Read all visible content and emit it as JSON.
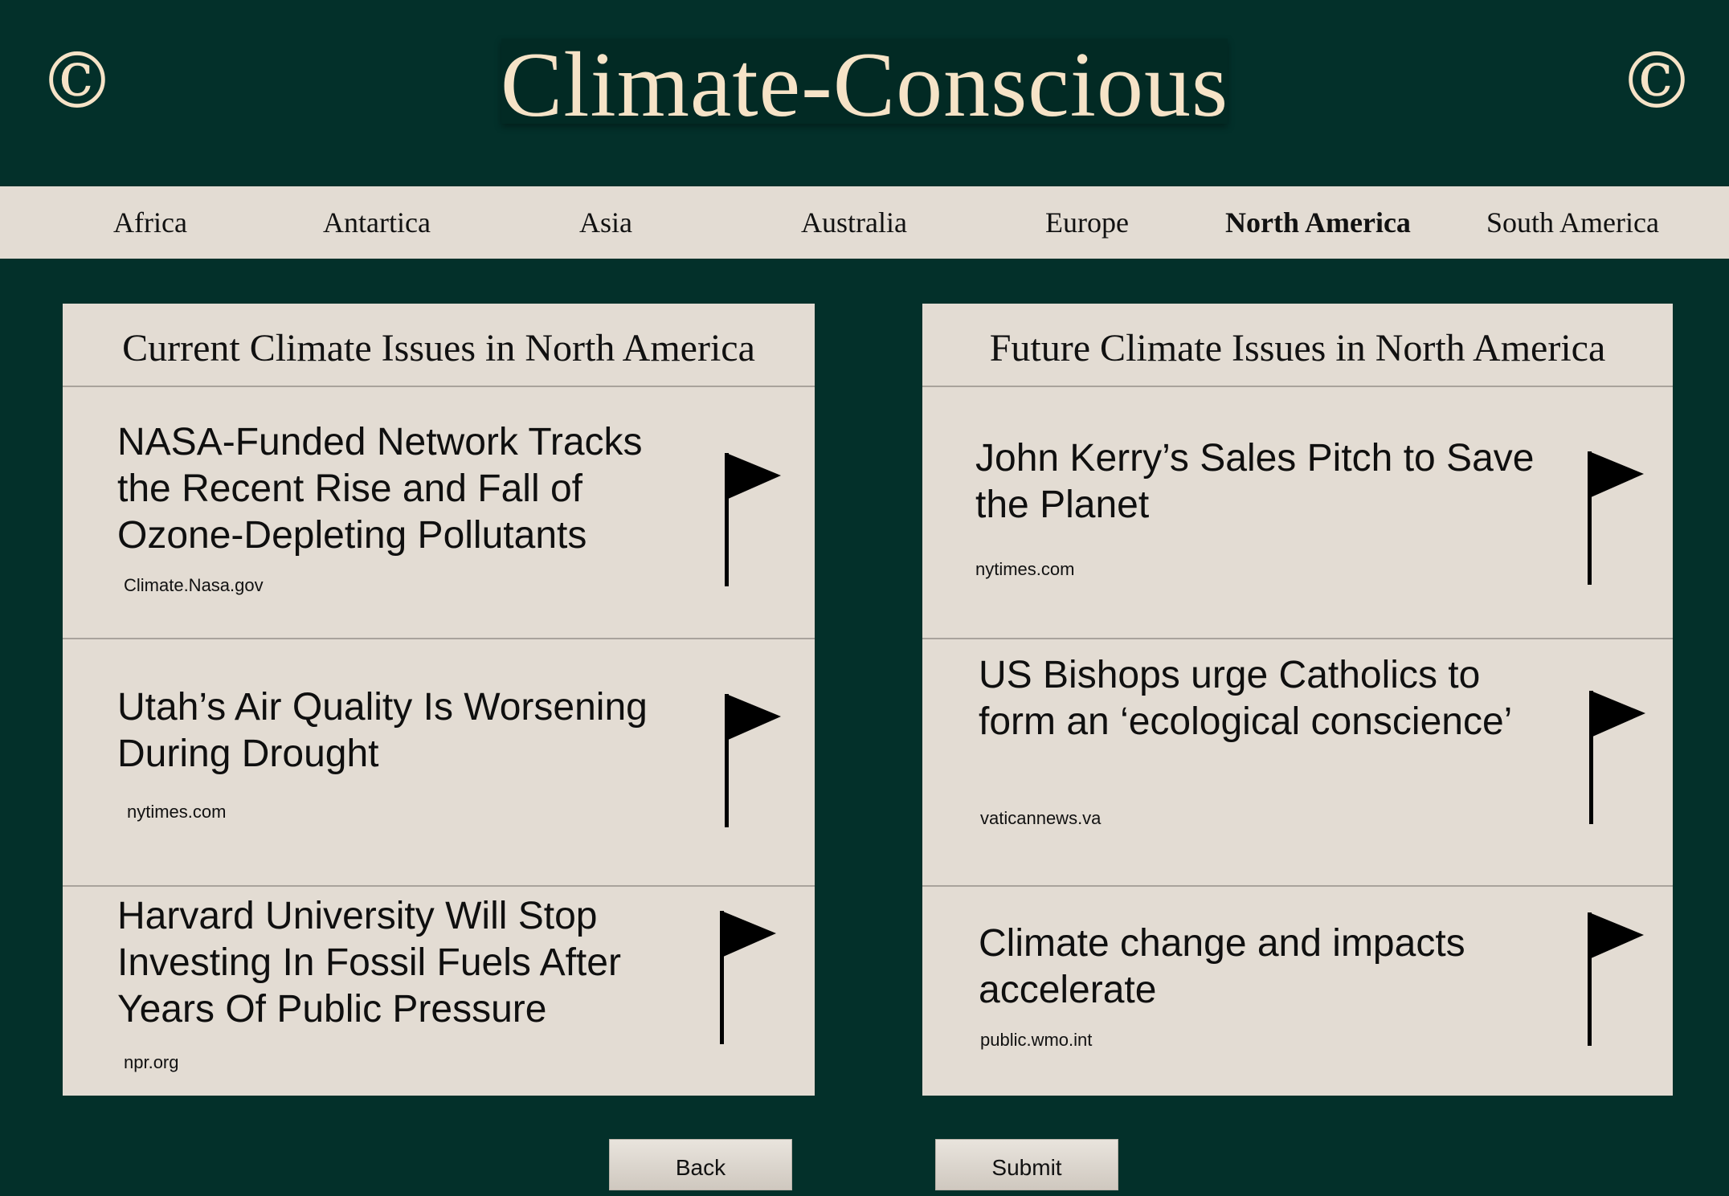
{
  "header": {
    "title": "Climate-Conscious",
    "logo_glyph": "©",
    "colors": {
      "background": "#03302a",
      "title_text": "#f6e3c7",
      "panel": "#e3dcd3"
    }
  },
  "nav": {
    "items": [
      {
        "label": "Africa"
      },
      {
        "label": "Antartica"
      },
      {
        "label": "Asia"
      },
      {
        "label": "Australia"
      },
      {
        "label": "Europe"
      },
      {
        "label": "North America",
        "active": true
      },
      {
        "label": "South America"
      }
    ]
  },
  "current": {
    "title": "Current Climate Issues in North America",
    "articles": [
      {
        "headline": "NASA-Funded Network Tracks the Recent Rise and Fall of Ozone-Depleting Pollutants",
        "source": "Climate.Nasa.gov",
        "icon": "flag-icon"
      },
      {
        "headline": "Utah’s Air Quality Is Worsening During Drought",
        "source": "nytimes.com",
        "icon": "flag-icon"
      },
      {
        "headline": "Harvard University Will Stop Investing In Fossil Fuels After Years Of Public Pressure",
        "source": "npr.org",
        "icon": "flag-icon"
      }
    ]
  },
  "future": {
    "title": "Future Climate Issues in North America",
    "articles": [
      {
        "headline": "John Kerry’s Sales Pitch to Save the Planet",
        "source": "nytimes.com",
        "icon": "flag-icon"
      },
      {
        "headline": "US Bishops urge Catholics to form an ‘ecological conscience’",
        "source": "vaticannews.va",
        "icon": "flag-icon"
      },
      {
        "headline": "Climate change and impacts accelerate",
        "source": "public.wmo.int",
        "icon": "flag-icon"
      }
    ]
  },
  "buttons": {
    "back_label": "Back",
    "submit_label": "Submit"
  }
}
